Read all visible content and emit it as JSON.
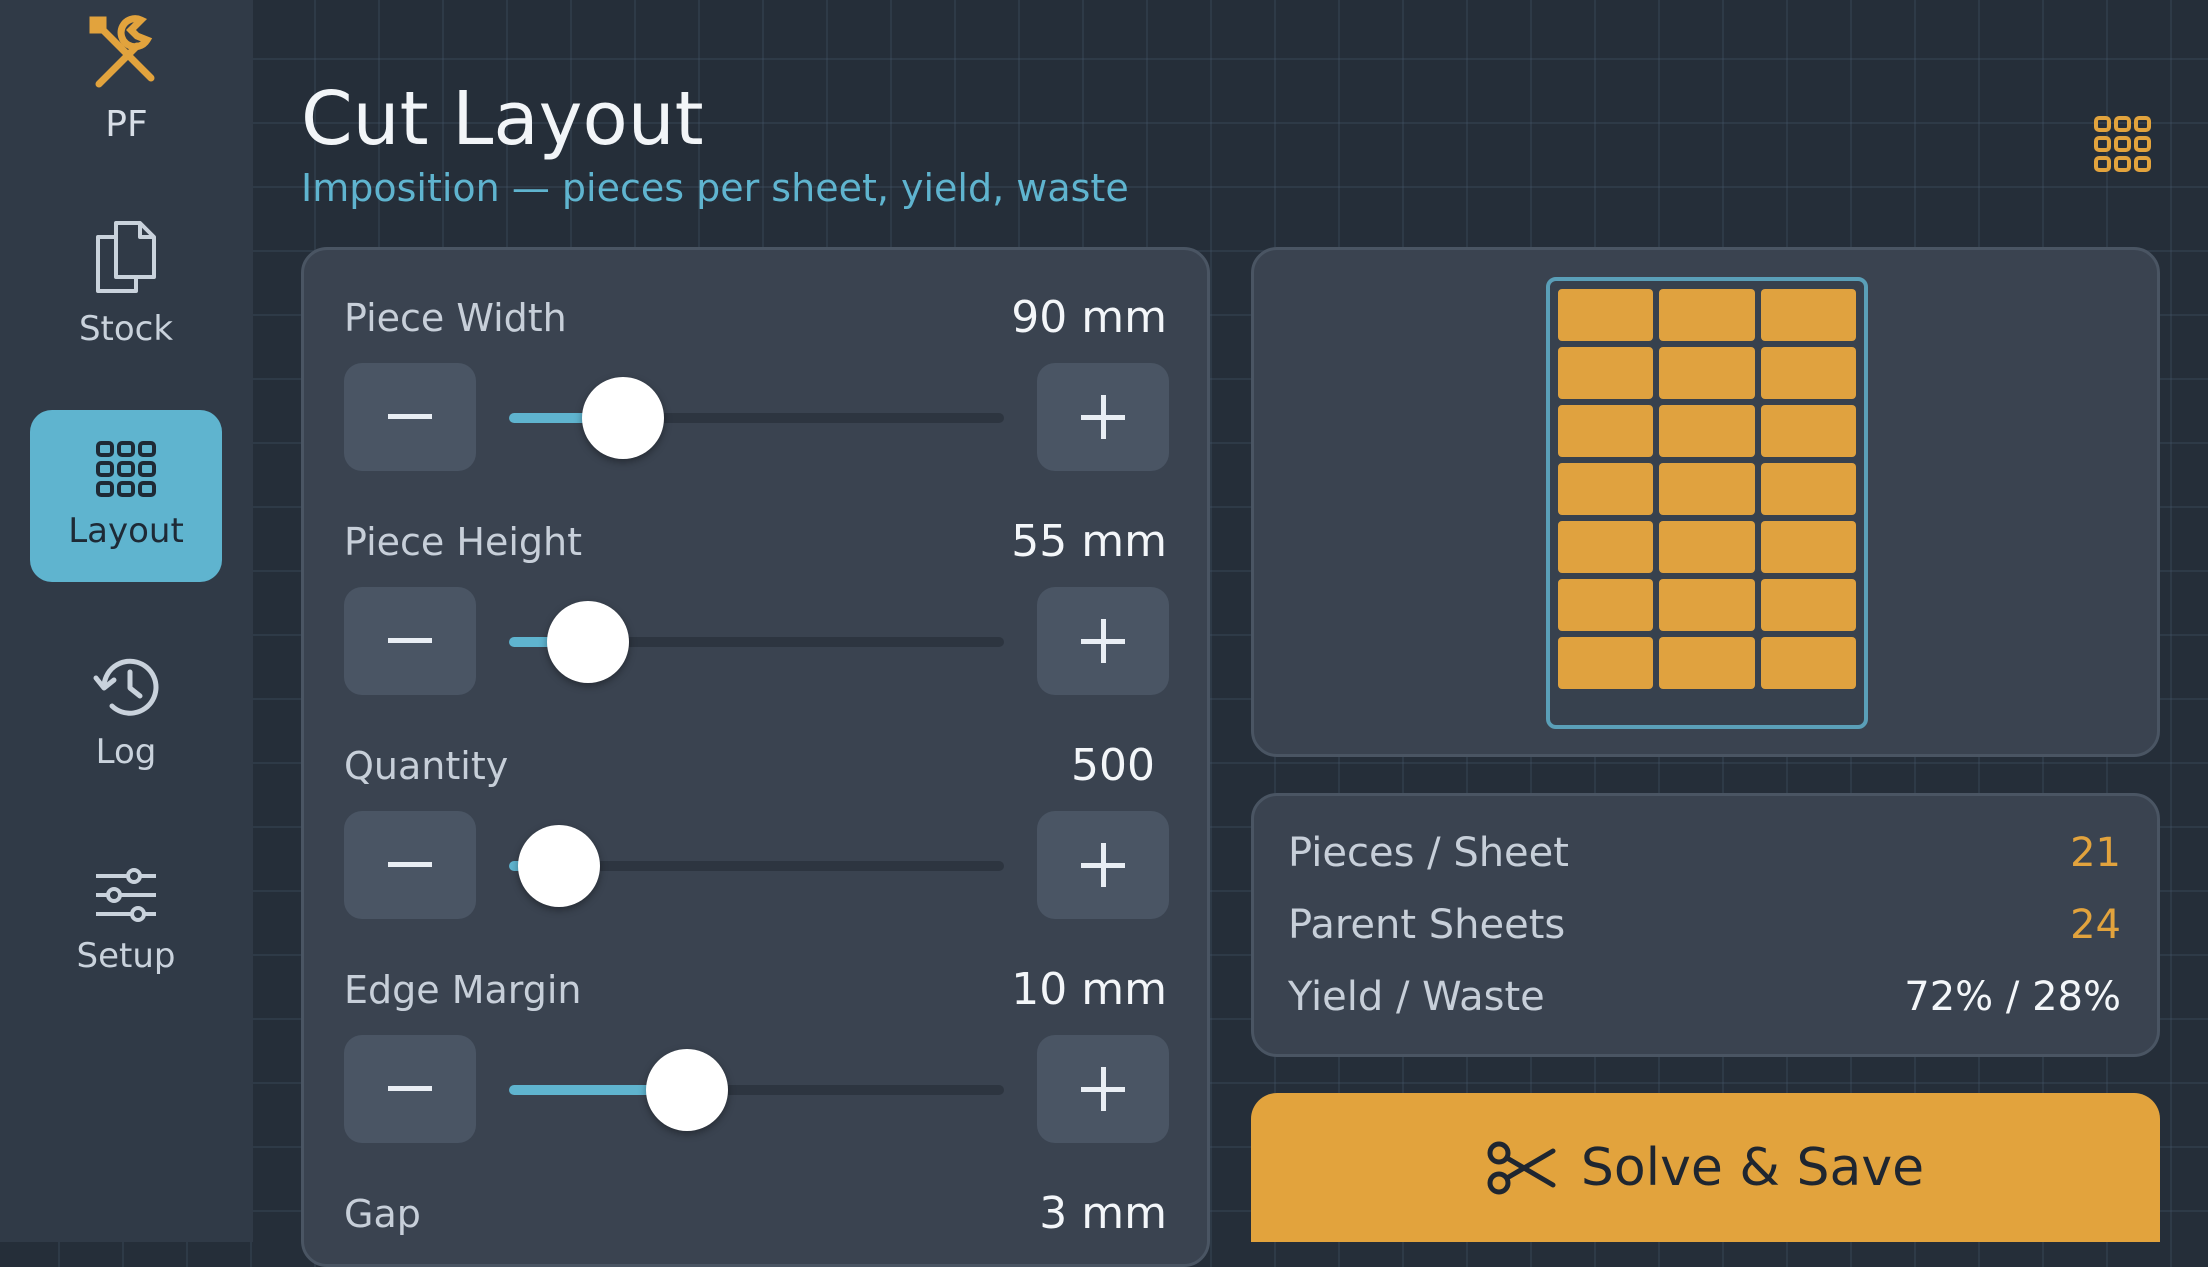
{
  "app": {
    "logo_text": "PF"
  },
  "nav": [
    {
      "label": "Stock",
      "icon": "stock-icon",
      "active": false
    },
    {
      "label": "Layout",
      "icon": "grid-icon",
      "active": true
    },
    {
      "label": "Log",
      "icon": "history-icon",
      "active": false
    },
    {
      "label": "Setup",
      "icon": "sliders-icon",
      "active": false
    }
  ],
  "header": {
    "title": "Cut Layout",
    "subtitle": "Imposition — pieces per sheet, yield, waste"
  },
  "controls": [
    {
      "label": "Piece Width",
      "value": "90 mm",
      "level": 0.23
    },
    {
      "label": "Piece Height",
      "value": "55 mm",
      "level": 0.16
    },
    {
      "label": "Quantity",
      "value": "500",
      "level": 0.1
    },
    {
      "label": "Edge Margin",
      "value": "10 mm",
      "level": 0.36
    },
    {
      "label": "Gap",
      "value": "3 mm"
    }
  ],
  "preview": {
    "columns": 3,
    "rows": 7
  },
  "stats": [
    {
      "label": "Pieces / Sheet",
      "value": "21",
      "color": "#e2a33d"
    },
    {
      "label": "Parent Sheets",
      "value": "24",
      "color": "#e2a33d"
    },
    {
      "label": "Yield / Waste",
      "value": "72% / 28%",
      "color": "#f3f6f9"
    }
  ],
  "cta": {
    "label": "Solve & Save",
    "icon": "scissors-icon"
  },
  "colors": {
    "accent": "#e2a33d",
    "primary": "#5fb4cf",
    "background": "#252e39"
  }
}
